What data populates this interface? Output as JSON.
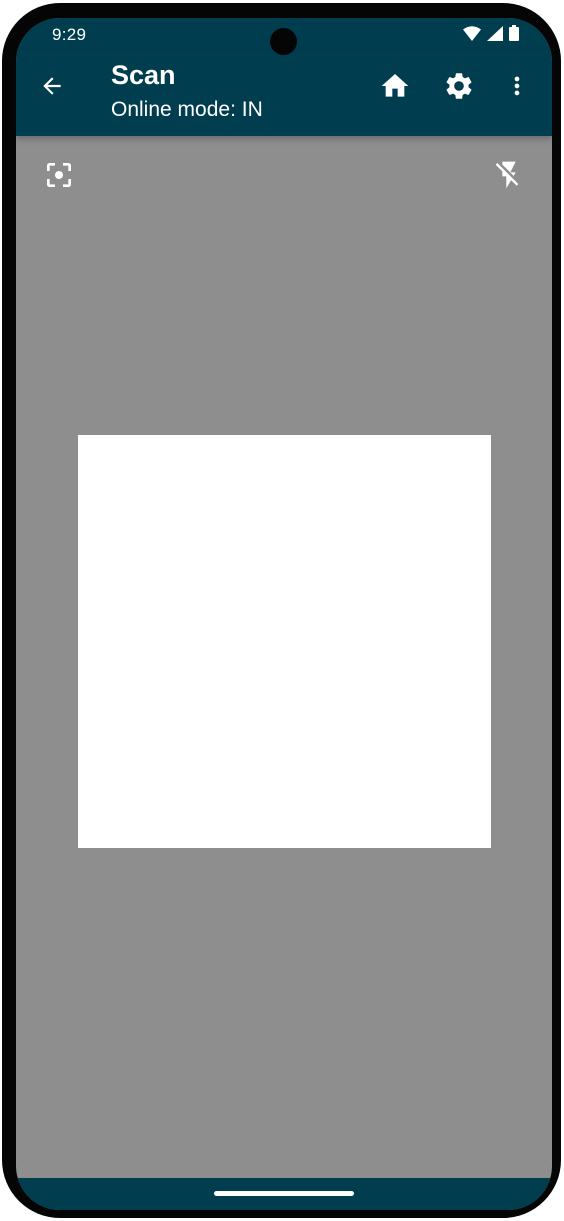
{
  "status_bar": {
    "time": "9:29"
  },
  "app_bar": {
    "title": "Scan",
    "subtitle": "Online mode: IN",
    "back_icon": "arrow-left-icon",
    "actions": [
      {
        "name": "home",
        "icon": "home-icon"
      },
      {
        "name": "settings",
        "icon": "gear-icon"
      },
      {
        "name": "more",
        "icon": "more-vert-icon"
      }
    ]
  },
  "camera_controls": {
    "focus_icon": "center-focus-icon",
    "flash_icon": "flash-off-icon"
  },
  "colors": {
    "app_bar": "#003d4f",
    "camera_background": "#8e8e8e",
    "scan_area": "#ffffff"
  }
}
